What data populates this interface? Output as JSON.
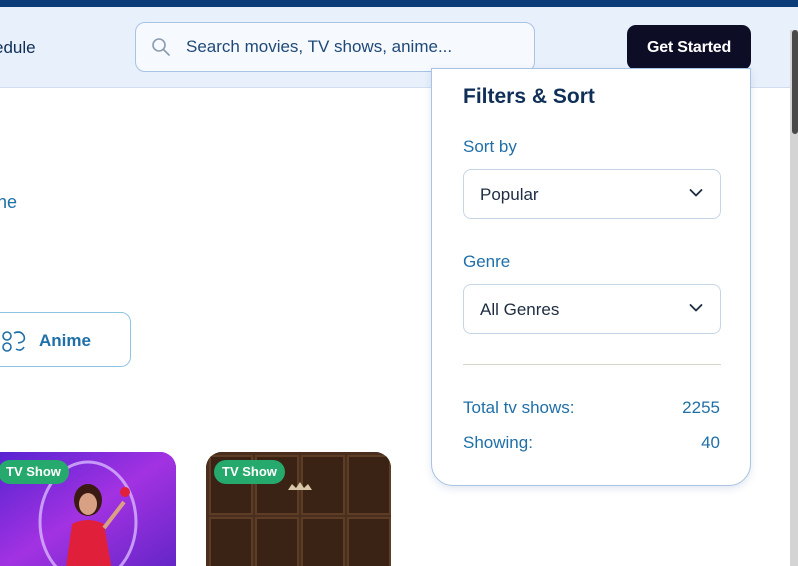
{
  "nav": {
    "schedule_label_partial": "edule"
  },
  "search": {
    "placeholder": "Search movies, TV shows, anime..."
  },
  "header": {
    "cta_label": "Get Started"
  },
  "main": {
    "link_partial": "ne",
    "category_chip": {
      "label": "Anime",
      "icon": "anime-icon"
    }
  },
  "cards": [
    {
      "badge": "TV Show"
    },
    {
      "badge": "TV Show"
    }
  ],
  "filters": {
    "title": "Filters & Sort",
    "sort_label": "Sort by",
    "sort_value": "Popular",
    "genre_label": "Genre",
    "genre_value": "All Genres",
    "total_label": "Total tv shows:",
    "total_value": "2255",
    "showing_label": "Showing:",
    "showing_value": "40"
  },
  "colors": {
    "accent": "#1f6fa8",
    "badge": "#26a96c",
    "cta": "#0d0d26",
    "header_bg": "#e8f0fb"
  }
}
